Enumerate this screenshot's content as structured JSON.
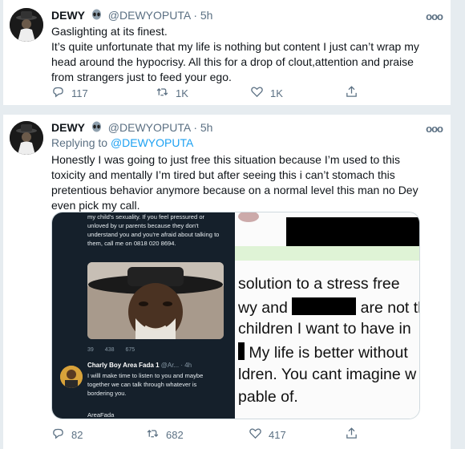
{
  "tweets": [
    {
      "name": "DEWY",
      "handle": "@DEWYOPUTA",
      "time": "· 5h",
      "more": "ooo",
      "lines": [
        "Gaslighting at its finest.",
        "It’s quite unfortunate that my life is nothing but content I just can’t wrap my head around the hypocrisy. All this for a drop of clout,attention and praise from strangers just to feed your ego."
      ],
      "replies": "117",
      "retweets": "1K",
      "likes": "1K"
    },
    {
      "name": "DEWY",
      "handle": "@DEWYOPUTA",
      "time": "· 5h",
      "more": "ooo",
      "replying_prefix": "Replying to",
      "replying_to": "@DEWYOPUTA",
      "text": "Honestly I was going to just free this situation because I’m used to this toxicity and mentally I’m tired but after seeing this i can’t stomach this pretentious behavior anymore because on a normal level this man no Dey even pick my call.",
      "replies": "82",
      "retweets": "682",
      "likes": "417",
      "media_left": {
        "text": "my child's sexuality. If you feel pressured or unloved by ur parents because they don't understand you and you're afraid about talking to them, call me on 0818 020 8694.",
        "stats": [
          "39",
          "438",
          "675"
        ],
        "author_name": "Charly Boy Area Fada 1",
        "author_meta": "@Ar... · 4h",
        "reply_text": "I willl make time to listen to you and maybe together we can talk through whatever is bordering you.",
        "signature": "AreaFada"
      },
      "media_right": {
        "line1": "solution to a stress free",
        "line2a": "wy and",
        "line2b": "are not th",
        "line3": "children I want to have in",
        "line4": "My life is better without",
        "line5": "ldren. You cant imagine w",
        "line6": "pable of."
      }
    }
  ],
  "colors": {
    "accent": "#1da1f2",
    "secondary_text": "#5b7083",
    "background": "#e6ecf0"
  }
}
